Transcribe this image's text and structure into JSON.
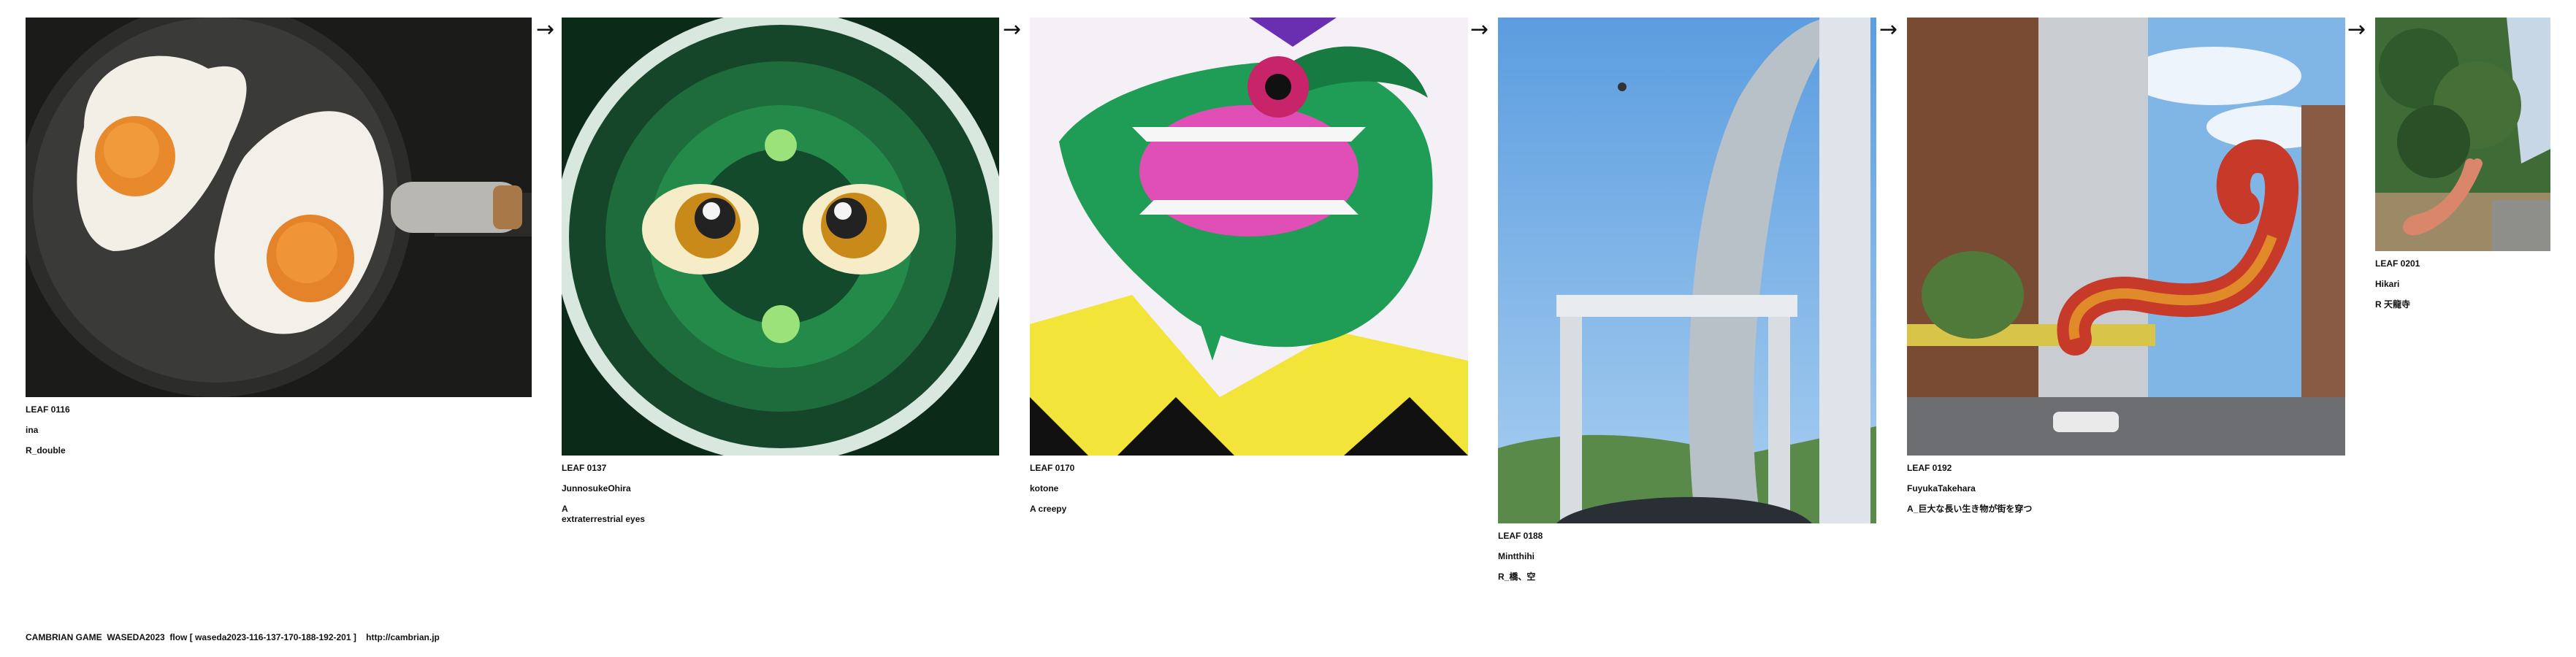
{
  "leaves": [
    {
      "label": "LEAF 0116",
      "author": "ina",
      "note": "R_double"
    },
    {
      "label": "LEAF 0137",
      "author": "JunnosukeOhira",
      "note": "A",
      "note2": "extraterrestrial eyes"
    },
    {
      "label": "LEAF 0170",
      "author": "kotone",
      "note": "A creepy"
    },
    {
      "label": "LEAF 0188",
      "author": "Mintthihi",
      "note": "R_橋、空"
    },
    {
      "label": "LEAF 0192",
      "author": "FuyukaTakehara",
      "note": "A_巨大な長い生き物が街を穿つ"
    },
    {
      "label": "LEAF 0201",
      "author": "Hikari",
      "note": "R 天龍寺"
    }
  ],
  "footer": "CAMBRIAN GAME  WASEDA2023  flow [ waseda2023-116-137-170-188-192-201 ]    http://cambrian.jp",
  "arrow_glyph": "→",
  "images": [
    {
      "icon": "fried-eggs-photo"
    },
    {
      "icon": "alien-eyes-art"
    },
    {
      "icon": "crocodile-illustration"
    },
    {
      "icon": "bridge-photo"
    },
    {
      "icon": "giant-worm-street-image"
    },
    {
      "icon": "tree-worm-photo"
    }
  ]
}
